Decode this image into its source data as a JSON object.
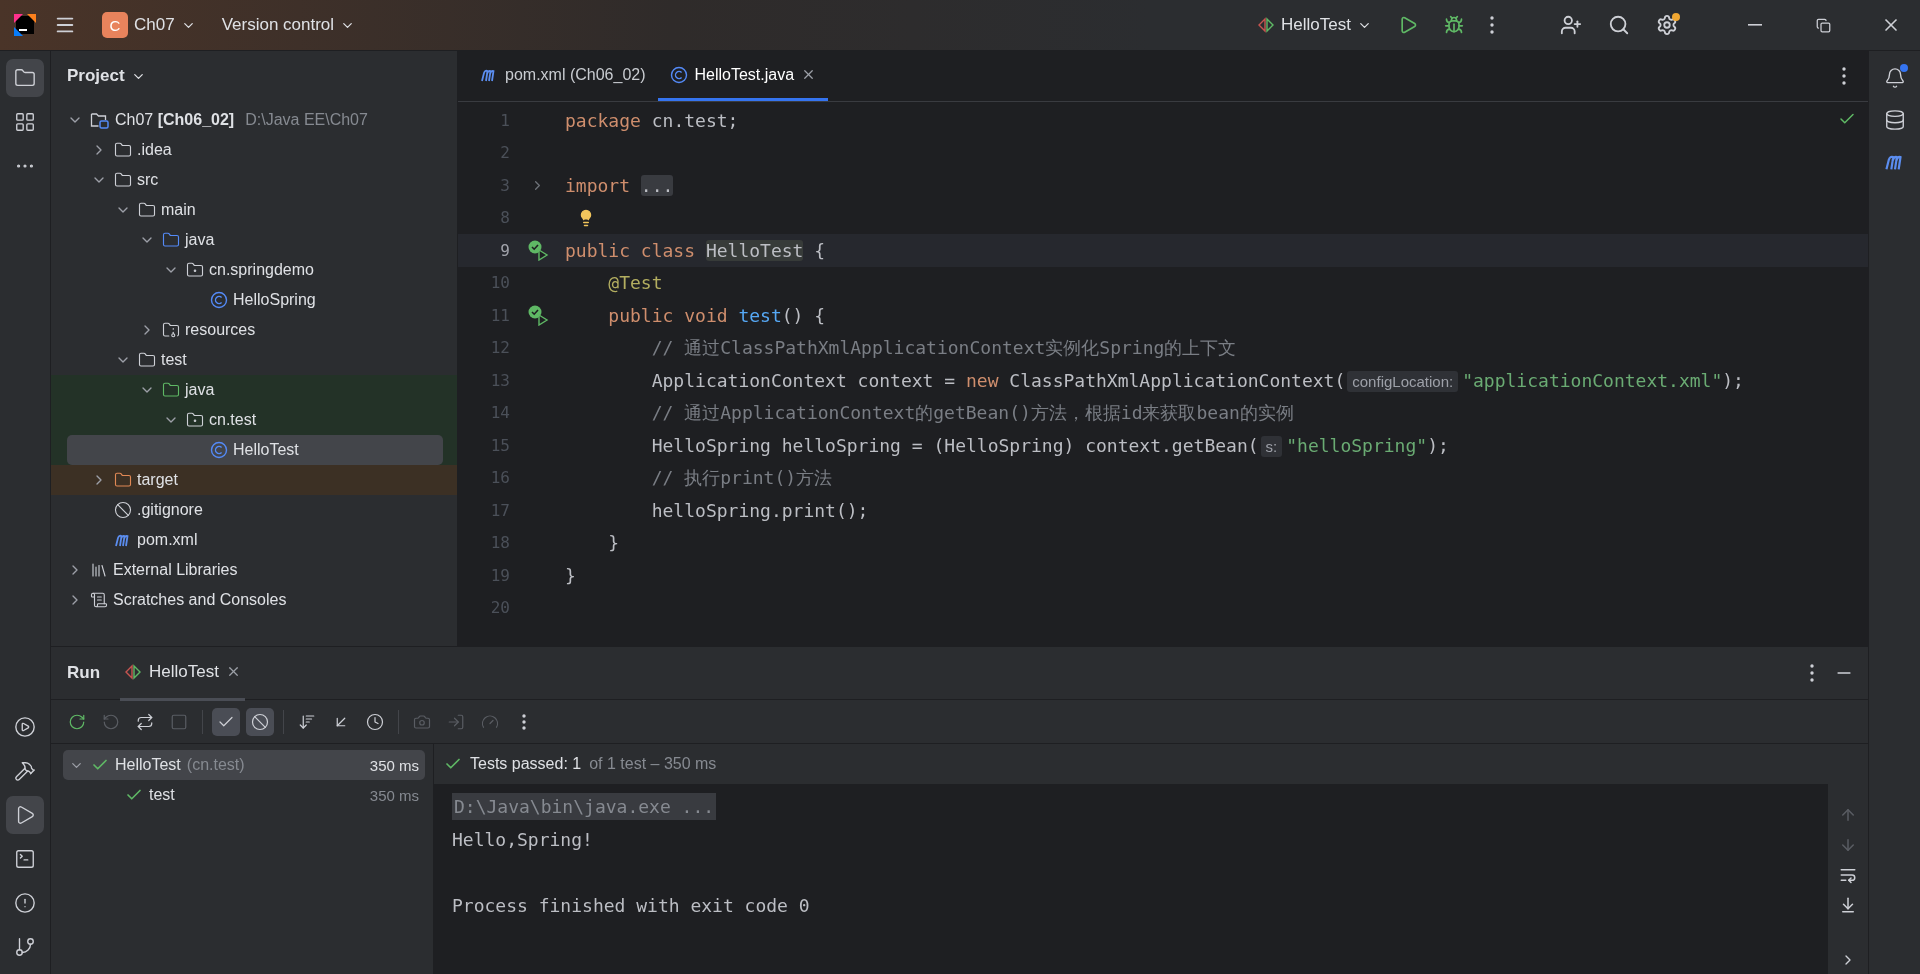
{
  "title_bar": {
    "project_badge": "C",
    "project": "Ch07",
    "vcs": "Version control",
    "run_config": "HelloTest"
  },
  "left_stripe": {
    "top": [
      {
        "kind": "project",
        "selected": true
      },
      {
        "kind": "structure",
        "selected": false
      },
      {
        "kind": "more",
        "selected": false
      }
    ],
    "bottom": [
      {
        "kind": "services",
        "selected": false
      },
      {
        "kind": "build",
        "selected": false
      },
      {
        "kind": "run",
        "selected": true
      },
      {
        "kind": "terminal",
        "selected": false
      },
      {
        "kind": "problems",
        "selected": false
      },
      {
        "kind": "git",
        "selected": false
      }
    ]
  },
  "project_panel": {
    "title": "Project",
    "tree": [
      {
        "label": "Ch07 **[Ch06_02]**",
        "path": "D:\\Java EE\\Ch07",
        "kind": "module",
        "expanded": true,
        "selected": false,
        "children": [
          {
            "label": ".idea",
            "kind": "folder",
            "expanded": false,
            "selected": false
          },
          {
            "label": "src",
            "kind": "folder",
            "expanded": true,
            "selected": false,
            "children": [
              {
                "label": "main",
                "kind": "folder",
                "expanded": true,
                "selected": false,
                "children": [
                  {
                    "label": "java",
                    "kind": "source-folder",
                    "expanded": true,
                    "selected": false,
                    "children": [
                      {
                        "label": "cn.springdemo",
                        "kind": "package",
                        "expanded": true,
                        "selected": false,
                        "children": [
                          {
                            "label": "HelloSpring",
                            "kind": "class",
                            "selected": false
                          }
                        ]
                      }
                    ]
                  },
                  {
                    "label": "resources",
                    "kind": "resources",
                    "expanded": false,
                    "selected": false
                  }
                ]
              },
              {
                "label": "test",
                "kind": "folder",
                "expanded": true,
                "selected": false,
                "children": [
                  {
                    "label": "java",
                    "kind": "test-folder",
                    "expanded": true,
                    "selected": false,
                    "children": [
                      {
                        "label": "cn.test",
                        "kind": "package",
                        "expanded": true,
                        "selected": false,
                        "children": [
                          {
                            "label": "HelloTest",
                            "kind": "class",
                            "selected": true
                          }
                        ]
                      }
                    ]
                  }
                ]
              }
            ]
          },
          {
            "label": "target",
            "kind": "excluded-folder",
            "expanded": false,
            "selected": false
          },
          {
            "label": ".gitignore",
            "kind": "ignore",
            "selected": false
          },
          {
            "label": "pom.xml",
            "kind": "maven",
            "selected": false
          }
        ]
      },
      {
        "label": "External Libraries",
        "kind": "libraries",
        "expanded": false,
        "selected": false
      },
      {
        "label": "Scratches and Consoles",
        "kind": "scratches",
        "expanded": false,
        "selected": false
      }
    ]
  },
  "editor": {
    "tabs": [
      {
        "label": "pom.xml (Ch06_02)",
        "kind": "maven",
        "selected": false
      },
      {
        "label": "HelloTest.java",
        "kind": "class",
        "selected": true
      }
    ],
    "lines": [
      {
        "number": "1",
        "tokens": [
          {
            "kind": "keyword",
            "text": "package "
          },
          {
            "kind": "plain",
            "text": "cn.test;"
          }
        ]
      },
      {
        "number": "2"
      },
      {
        "number": "3",
        "folded": true,
        "tokens": [
          {
            "kind": "keyword",
            "text": "import "
          },
          {
            "kind": "folded",
            "text": "..."
          }
        ]
      },
      {
        "number": "8",
        "bulb": true
      },
      {
        "number": "9",
        "test_passed": true,
        "current": true,
        "tokens": [
          {
            "kind": "keyword",
            "text": "public class "
          },
          {
            "kind": "usage",
            "text": "HelloTest"
          },
          {
            "kind": "plain",
            "text": " {"
          }
        ]
      },
      {
        "number": "10",
        "tokens": [
          {
            "kind": "annotation",
            "text": "    @Test"
          }
        ]
      },
      {
        "number": "11",
        "test_passed": true,
        "tokens": [
          {
            "kind": "keyword",
            "text": "    public void "
          },
          {
            "kind": "method",
            "text": "test"
          },
          {
            "kind": "plain",
            "text": "() {"
          }
        ]
      },
      {
        "number": "12",
        "tokens": [
          {
            "kind": "comment",
            "text": "        // 通过ClassPathXmlApplicationContext实例化Spring的上下文"
          }
        ]
      },
      {
        "number": "13",
        "tokens": [
          {
            "kind": "plain",
            "text": "        ApplicationContext context = "
          },
          {
            "kind": "keyword",
            "text": "new "
          },
          {
            "kind": "plain",
            "text": "ClassPathXmlApplicationContext("
          },
          {
            "kind": "hint",
            "text": "configLocation:"
          },
          {
            "kind": "string",
            "text": "\"applicationContext.xml\""
          },
          {
            "kind": "plain",
            "text": ");"
          }
        ]
      },
      {
        "number": "14",
        "tokens": [
          {
            "kind": "comment",
            "text": "        // 通过ApplicationContext的getBean()方法，根据id来获取bean的实例"
          }
        ]
      },
      {
        "number": "15",
        "tokens": [
          {
            "kind": "plain",
            "text": "        HelloSpring helloSpring = (HelloSpring) context.getBean("
          },
          {
            "kind": "hint",
            "text": "s:"
          },
          {
            "kind": "string",
            "text": "\"helloSpring\""
          },
          {
            "kind": "plain",
            "text": ");"
          }
        ]
      },
      {
        "number": "16",
        "tokens": [
          {
            "kind": "comment",
            "text": "        // 执行print()方法"
          }
        ]
      },
      {
        "number": "17",
        "tokens": [
          {
            "kind": "plain",
            "text": "        helloSpring.print();"
          }
        ]
      },
      {
        "number": "18",
        "tokens": [
          {
            "kind": "plain",
            "text": "    }"
          }
        ]
      },
      {
        "number": "19",
        "tokens": [
          {
            "kind": "plain",
            "text": "}"
          }
        ]
      },
      {
        "number": "20"
      }
    ]
  },
  "run_panel": {
    "title": "Run",
    "tabs": [
      {
        "label": "HelloTest",
        "selected": true
      }
    ],
    "toolbar": [
      {
        "kind": "rerun",
        "disabled": false
      },
      {
        "kind": "rerun-failed",
        "disabled": true
      },
      {
        "kind": "auto-test",
        "disabled": false
      },
      {
        "kind": "stop",
        "disabled": true
      },
      {
        "kind": "separator"
      },
      {
        "kind": "show-passed",
        "selected": true
      },
      {
        "kind": "show-ignored",
        "selected": true
      },
      {
        "kind": "separator"
      },
      {
        "kind": "sort",
        "disabled": false
      },
      {
        "kind": "collapse",
        "disabled": false
      },
      {
        "kind": "history",
        "disabled": false
      },
      {
        "kind": "separator"
      },
      {
        "kind": "screenshot",
        "disabled": true
      },
      {
        "kind": "import",
        "disabled": true
      },
      {
        "kind": "profile",
        "disabled": true
      },
      {
        "kind": "more",
        "disabled": false
      }
    ],
    "tests": [
      {
        "name": "HelloTest",
        "package": "(cn.test)",
        "time": "350 ms",
        "passed": true,
        "expanded": true,
        "selected": true,
        "children": [
          {
            "name": "test",
            "time": "350 ms",
            "passed": true,
            "selected": false
          }
        ]
      }
    ],
    "status": {
      "main": "Tests passed: 1",
      "detail": "of 1 test – 350 ms"
    },
    "console": [
      {
        "kind": "command",
        "text": "D:\\Java\\bin\\java.exe ..."
      },
      {
        "kind": "output",
        "text": "Hello,Spring!"
      },
      {
        "kind": "blank"
      },
      {
        "kind": "output",
        "text": "Process finished with exit code 0"
      }
    ]
  },
  "right_stripe": [
    {
      "kind": "notifications",
      "badge": true
    },
    {
      "kind": "database"
    },
    {
      "kind": "maven"
    }
  ]
}
